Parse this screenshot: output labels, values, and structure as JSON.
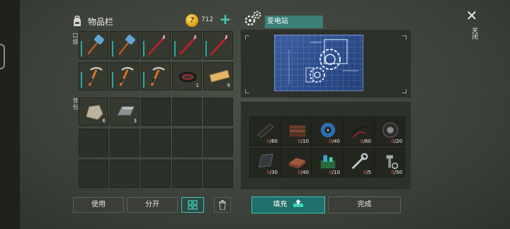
{
  "inventory": {
    "title": "物品栏",
    "coins": "712",
    "hotbar_label": "口袋",
    "backpack_label": "背包",
    "hotbar": [
      {
        "icon": "sledgehammer-icon",
        "count": ""
      },
      {
        "icon": "sledgehammer-icon",
        "count": ""
      },
      {
        "icon": "crowbar-icon",
        "count": ""
      },
      {
        "icon": "crowbar-icon",
        "count": ""
      },
      {
        "icon": "crowbar-icon",
        "count": ""
      },
      {
        "icon": "pickaxe-icon",
        "count": ""
      },
      {
        "icon": "pickaxe-icon",
        "count": ""
      },
      {
        "icon": "pickaxe-icon",
        "count": ""
      },
      {
        "icon": "wire-coil-icon",
        "count": "1"
      },
      {
        "icon": "wood-plank-icon",
        "count": "9"
      }
    ],
    "backpack": [
      {
        "icon": "stone-icon",
        "count": "6"
      },
      {
        "icon": "iron-ingot-icon",
        "count": "3"
      }
    ]
  },
  "buttons": {
    "use": "使用",
    "split": "分开",
    "fill": "填充",
    "done": "完成",
    "close": "关闭"
  },
  "station": {
    "name": "变电站"
  },
  "materials": [
    {
      "icon": "rubber-icon",
      "have": "0",
      "need": "/60"
    },
    {
      "icon": "planks-icon",
      "have": "0",
      "need": "/10"
    },
    {
      "icon": "cable-spool-icon",
      "have": "0",
      "need": "/40"
    },
    {
      "icon": "wires-icon",
      "have": "0",
      "need": "/60"
    },
    {
      "icon": "tire-icon",
      "have": "0",
      "need": "/20"
    },
    {
      "icon": "glass-icon",
      "have": "0",
      "need": "/30"
    },
    {
      "icon": "brick-icon",
      "have": "0",
      "need": "/40"
    },
    {
      "icon": "electronics-icon",
      "have": "0",
      "need": "/10"
    },
    {
      "icon": "wrench-icon",
      "have": "0",
      "need": "/5"
    },
    {
      "icon": "bolts-icon",
      "have": "0",
      "need": "/50"
    }
  ],
  "colors": {
    "accent": "#3fc7bb",
    "missing": "#e0584e",
    "blueprint": "#2a4a8a"
  }
}
